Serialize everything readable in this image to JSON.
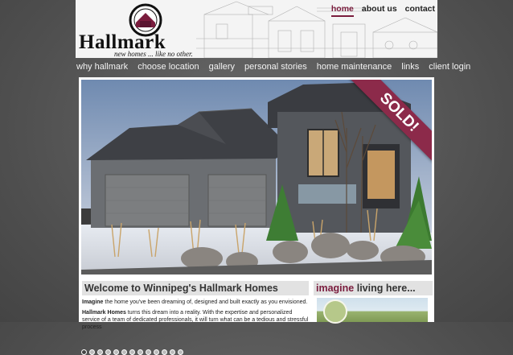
{
  "logo": {
    "wordmark": "Hallmark",
    "tagline": "new homes ... like no other."
  },
  "top_nav": [
    {
      "label": "home",
      "active": true
    },
    {
      "label": "about us",
      "active": false
    },
    {
      "label": "contact",
      "active": false
    }
  ],
  "main_nav": [
    "why hallmark",
    "choose location",
    "gallery",
    "personal stories",
    "home maintenance",
    "links",
    "client login"
  ],
  "hero": {
    "ribbon": "SOLD!",
    "slide_count": 13,
    "active_slide": 1
  },
  "welcome": {
    "heading": "Welcome to Winnipeg's Hallmark Homes",
    "p1_lead": "Imagine",
    "p1_rest": " the home you've been dreaming of, designed and built exactly as you envisioned.",
    "p2_lead": "Hallmark Homes",
    "p2_rest": " turns this dream into a reality. With the expertise and personalized service of a team of dedicated professionals, it will turn what can be a tedious and stressful process"
  },
  "imagine": {
    "accent": "imagine",
    "rest": " living here..."
  },
  "colors": {
    "brand": "#7a1c3d",
    "ribbon": "#8c2a4a"
  }
}
